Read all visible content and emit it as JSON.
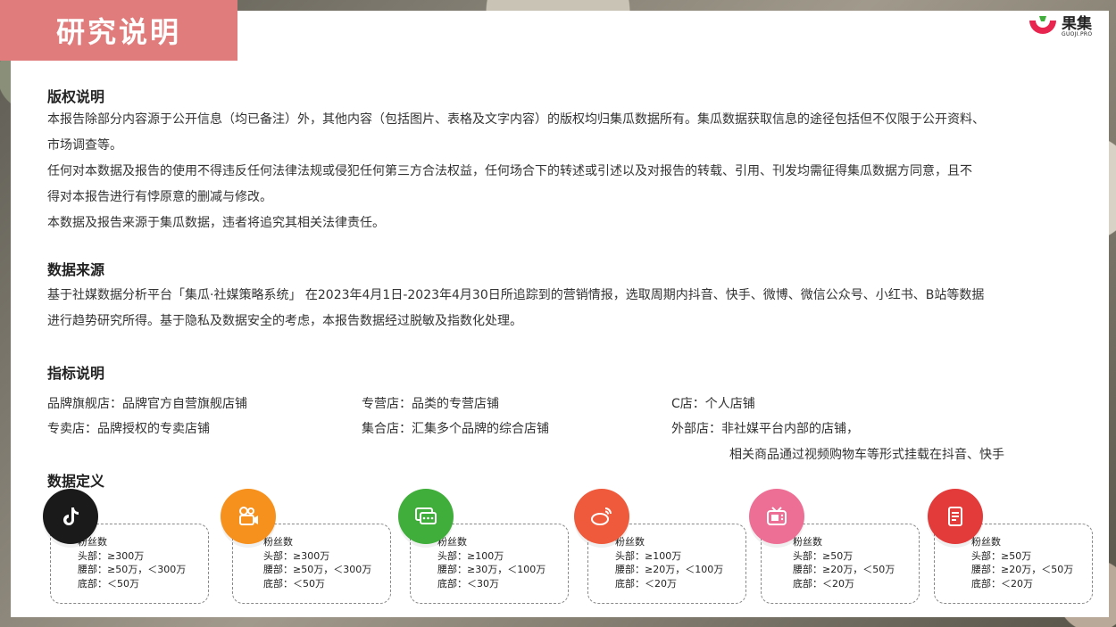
{
  "header": {
    "title": "研究说明",
    "logo_cn": "果集",
    "logo_en": "GUOJI.PRO"
  },
  "copyright": {
    "heading": "版权说明",
    "lines": [
      "本报告除部分内容源于公开信息（均已备注）外，其他内容（包括图片、表格及文字内容）的版权均归集瓜数据所有。集瓜数据获取信息的途径包括但不仅限于公开资料、",
      "市场调查等。",
      "任何对本数据及报告的使用不得违反任何法律法规或侵犯任何第三方合法权益，任何场合下的转述或引述以及对报告的转载、引用、刊发均需征得集瓜数据方同意，且不",
      "得对本报告进行有悖原意的删减与修改。",
      "本数据及报告来源于集瓜数据，违者将追究其相关法律责任。"
    ]
  },
  "source": {
    "heading": "数据来源",
    "lines": [
      "基于社媒数据分析平台「集瓜·社媒策略系统」 在2023年4月1日-2023年4月30日所追踪到的营销情报，选取周期内抖音、快手、微博、微信公众号、小红书、B站等数据",
      "进行趋势研究所得。基于隐私及数据安全的考虑，本报告数据经过脱敏及指数化处理。"
    ]
  },
  "metrics": {
    "heading": "指标说明",
    "items": [
      "品牌旗舰店：品牌官方自营旗舰店铺",
      "专营店：品类的专营店铺",
      "C店：个人店铺",
      "专卖店：品牌授权的专卖店铺",
      "集合店：汇集多个品牌的综合店铺",
      "外部店：非社媒平台内部的店铺，",
      "相关商品通过视频购物车等形式挂载在抖音、快手"
    ]
  },
  "definitions": {
    "heading": "数据定义",
    "cards": [
      {
        "icon": "douyin-icon",
        "color": "#1a1a1a",
        "lines": [
          "粉丝数",
          "头部：≥300万",
          "腰部：≥50万，＜300万",
          "底部：＜50万"
        ]
      },
      {
        "icon": "kuaishou-icon",
        "color": "#f7911e",
        "lines": [
          "粉丝数",
          "头部：≥300万",
          "腰部：≥50万，＜300万",
          "底部：＜50万"
        ]
      },
      {
        "icon": "wechat-icon",
        "color": "#3fae3a",
        "lines": [
          "粉丝数",
          "头部：≥100万",
          "腰部：≥30万，＜100万",
          "底部：＜30万"
        ]
      },
      {
        "icon": "weibo-icon",
        "color": "#ef5a3c",
        "lines": [
          "粉丝数",
          "头部：≥100万",
          "腰部：≥20万，＜100万",
          "底部：＜20万"
        ]
      },
      {
        "icon": "bilibili-icon",
        "color": "#ee6f95",
        "lines": [
          "粉丝数",
          "头部：≥50万",
          "腰部：≥20万，＜50万",
          "底部：＜20万"
        ]
      },
      {
        "icon": "xiaohongshu-icon",
        "color": "#e33a3a",
        "lines": [
          "粉丝数",
          "头部：≥50万",
          "腰部：≥20万，＜50万",
          "底部：＜20万"
        ]
      }
    ]
  }
}
